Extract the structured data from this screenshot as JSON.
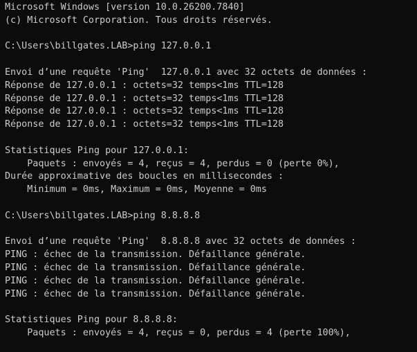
{
  "terminal": {
    "background": "#0c0c0c",
    "foreground": "#cccccc",
    "lines": [
      "Microsoft Windows [version 10.0.26200.7840]",
      "(c) Microsoft Corporation. Tous droits réservés.",
      "",
      "C:\\Users\\billgates.LAB>ping 127.0.0.1",
      "",
      "Envoi d’une requête 'Ping'  127.0.0.1 avec 32 octets de données :",
      "Réponse de 127.0.0.1 : octets=32 temps<1ms TTL=128",
      "Réponse de 127.0.0.1 : octets=32 temps<1ms TTL=128",
      "Réponse de 127.0.0.1 : octets=32 temps<1ms TTL=128",
      "Réponse de 127.0.0.1 : octets=32 temps<1ms TTL=128",
      "",
      "Statistiques Ping pour 127.0.0.1:",
      "    Paquets : envoyés = 4, reçus = 4, perdus = 0 (perte 0%),",
      "Durée approximative des boucles en millisecondes :",
      "    Minimum = 0ms, Maximum = 0ms, Moyenne = 0ms",
      "",
      "C:\\Users\\billgates.LAB>ping 8.8.8.8",
      "",
      "Envoi d’une requête 'Ping'  8.8.8.8 avec 32 octets de données :",
      "PING : échec de la transmission. Défaillance générale.",
      "PING : échec de la transmission. Défaillance générale.",
      "PING : échec de la transmission. Défaillance générale.",
      "PING : échec de la transmission. Défaillance générale.",
      "",
      "Statistiques Ping pour 8.8.8.8:",
      "    Paquets : envoyés = 4, reçus = 0, perdus = 4 (perte 100%),"
    ]
  }
}
